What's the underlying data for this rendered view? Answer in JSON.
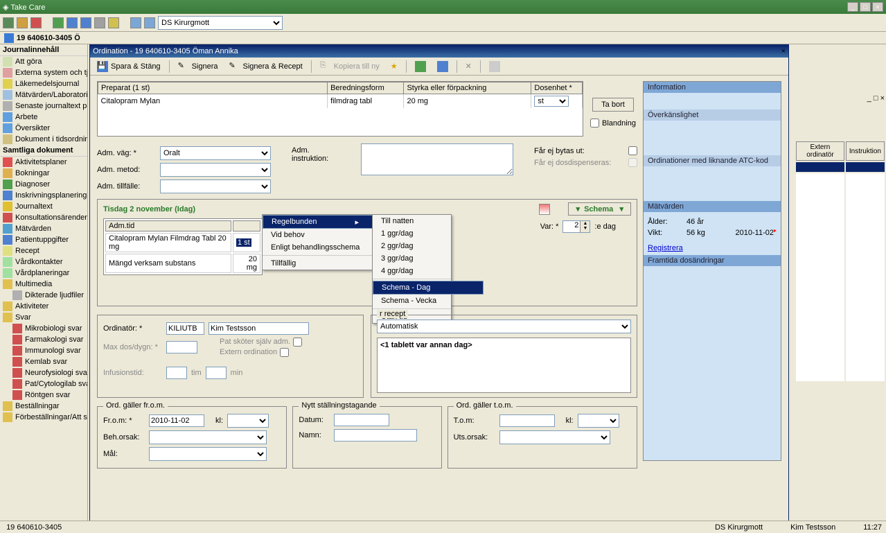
{
  "app": {
    "title": "Take Care"
  },
  "main_toolbar": {
    "dropdown": "DS Kirurgmott"
  },
  "patient_bar": "19  640610-3405 Ö",
  "left_nav": {
    "section1_title": "Journalinnehåll",
    "items1": [
      {
        "label": "Att göra",
        "color": "#d0e0b0"
      },
      {
        "label": "Externa system och tjänster",
        "color": "#e0a0a0"
      },
      {
        "label": "Läkemedelsjournal",
        "color": "#e0d050"
      },
      {
        "label": "Mätvärden/Laboratorielista",
        "color": "#a0c0e0"
      },
      {
        "label": "Senaste journaltext per sökord",
        "color": "#b0b0b0"
      },
      {
        "label": "Arbete",
        "color": "#60a0e0"
      },
      {
        "label": "Översikter",
        "color": "#60a0e0"
      },
      {
        "label": "Dokument i tidsordning",
        "color": "#d0c080"
      }
    ],
    "section2_title": "Samtliga dokument",
    "items2": [
      {
        "label": "Aktivitetsplaner",
        "color": "#e05050",
        "indent": false
      },
      {
        "label": "Bokningar",
        "color": "#e0b050",
        "indent": false
      },
      {
        "label": "Diagnoser",
        "color": "#50a050",
        "indent": false
      },
      {
        "label": "Inskrivningsplaneringar",
        "color": "#5080d0",
        "indent": false
      },
      {
        "label": "Journaltext",
        "color": "#e0c030",
        "indent": false
      },
      {
        "label": "Konsultationsärenden",
        "color": "#d05050",
        "indent": false
      },
      {
        "label": "Mätvärden",
        "color": "#50a0d0",
        "indent": false
      },
      {
        "label": "Patientuppgifter",
        "color": "#5080d0",
        "indent": false
      },
      {
        "label": "Recept",
        "color": "#e0e080",
        "indent": false
      },
      {
        "label": "Vårdkontakter",
        "color": "#a0e0a0",
        "indent": false
      },
      {
        "label": "Vårdplaneringar",
        "color": "#a0e0a0",
        "indent": false
      },
      {
        "label": "Multimedia",
        "color": "#e0c050",
        "indent": false
      },
      {
        "label": "Dikterade ljudfiler",
        "color": "#b0b0b0",
        "indent": true
      },
      {
        "label": "Aktiviteter",
        "color": "#e0c050",
        "indent": false
      },
      {
        "label": "Svar",
        "color": "#e0c050",
        "indent": false
      },
      {
        "label": "Mikrobiologi svar",
        "color": "#d05050",
        "indent": true
      },
      {
        "label": "Farmakologi svar",
        "color": "#d05050",
        "indent": true
      },
      {
        "label": "Immunologi svar",
        "color": "#d05050",
        "indent": true
      },
      {
        "label": "Kemlab svar",
        "color": "#d05050",
        "indent": true
      },
      {
        "label": "Neurofysiologi svar",
        "color": "#d05050",
        "indent": true
      },
      {
        "label": "Pat/Cytologilab svar",
        "color": "#d05050",
        "indent": true
      },
      {
        "label": "Röntgen svar",
        "color": "#d05050",
        "indent": true
      },
      {
        "label": "Beställningar",
        "color": "#e0c050",
        "indent": false
      },
      {
        "label": "Förbeställningar/Att skicka",
        "color": "#e0c050",
        "indent": false
      }
    ]
  },
  "bg_table": {
    "h1": "Extern ordinatör",
    "h2": "Instruktion"
  },
  "modal": {
    "title": "Ordination - 19 640610-3405 Öman Annika",
    "tb": {
      "save": "Spara & Stäng",
      "sign": "Signera",
      "signrecept": "Signera & Recept",
      "copy": "Kopiera till ny"
    },
    "prep": {
      "h_preparat": "Preparat (1 st)",
      "h_beredning": "Beredningsform",
      "h_styrka": "Styrka eller förpackning",
      "h_dosenhet": "Dosenhet *",
      "r_preparat": "Citalopram Mylan",
      "r_beredning": "filmdrag tabl",
      "r_styrka": "20 mg",
      "r_dosenhet": "st",
      "btn_tabort": "Ta bort",
      "lbl_blandning": "Blandning"
    },
    "adm": {
      "l_vag": "Adm. väg: *",
      "v_vag": "Oralt",
      "l_metod": "Adm. metod:",
      "l_tillfalle": "Adm. tillfälle:",
      "l_instruktion": "Adm. instruktion:",
      "l_bytas": "Får ej bytas ut:",
      "l_dosdisp": "Får ej dosdispenseras:"
    },
    "date_section": {
      "header": "Tisdag 2 november (Idag)",
      "schema_btn": "Schema",
      "tbl_h_admtid": "Adm.tid",
      "tbl_r1": "Citalopram Mylan Filmdrag Tabl 20 mg",
      "tbl_r1_val": "1 st",
      "tbl_r2": "Mängd verksam substans",
      "tbl_r2_val": "20 mg",
      "var_lbl": "Var: *",
      "var_val": "2",
      "var_suffix": ":e dag"
    },
    "menu1": [
      {
        "label": "Regelbunden",
        "sel": true,
        "arrow": true
      },
      {
        "label": "Vid behov"
      },
      {
        "label": "Enligt behandlingsschema"
      },
      {
        "label": "---"
      },
      {
        "label": "Tillfällig"
      }
    ],
    "menu2": [
      {
        "label": "Till natten"
      },
      {
        "label": "1 ggr/dag"
      },
      {
        "label": "2 ggr/dag"
      },
      {
        "label": "3 ggr/dag"
      },
      {
        "label": "4 ggr/dag"
      },
      {
        "label": "---"
      },
      {
        "label": "Schema - Dag",
        "sel": true
      },
      {
        "label": "Schema - Vecka"
      },
      {
        "label": "---"
      },
      {
        "label": "Utan tid"
      }
    ],
    "ord": {
      "l_ordinator": "Ordinatör: *",
      "v_ord_code": "KILIUTB",
      "v_ord_name": "Kim Testsson",
      "l_maxdos": "Max dos/dygn: *",
      "l_patskoter": "Pat sköter själv adm.",
      "l_extern": "Extern ordination",
      "l_infusion": "Infusionstid:",
      "u_tim": "tim",
      "u_min": "min",
      "l_recept": "r recept",
      "v_recept": "Automatisk",
      "v_dostext": "<1 tablett var annan dag>"
    },
    "grp_from": {
      "legend": "Ord. gäller fr.o.m.",
      "l_from": "Fr.o.m: *",
      "v_from": "2010-11-02",
      "l_kl": "kl:",
      "l_beh": "Beh.orsak:",
      "l_mal": "Mål:"
    },
    "grp_ny": {
      "legend": "Nytt ställningstagande",
      "l_datum": "Datum:",
      "l_namn": "Namn:"
    },
    "grp_tom": {
      "legend": "Ord. gäller t.o.m.",
      "l_tom": "T.o.m:",
      "l_kl": "kl:",
      "l_uts": "Uts.orsak:"
    }
  },
  "info": {
    "h_info": "Information",
    "h_over": "Överkänslighet",
    "h_atc": "Ordinationer med liknande ATC-kod",
    "h_matv": "Mätvärden",
    "l_alder": "Ålder:",
    "v_alder": "46 år",
    "l_vikt": "Vikt:",
    "v_vikt": "56 kg",
    "v_viktdt": "2010-11-02",
    "link_reg": "Registrera",
    "h_framtida": "Framtida dosändringar"
  },
  "statusbar": {
    "patient": "19  640610-3405",
    "unit": "DS Kirurgmott",
    "user": "Kim Testsson",
    "time": "11:27"
  }
}
